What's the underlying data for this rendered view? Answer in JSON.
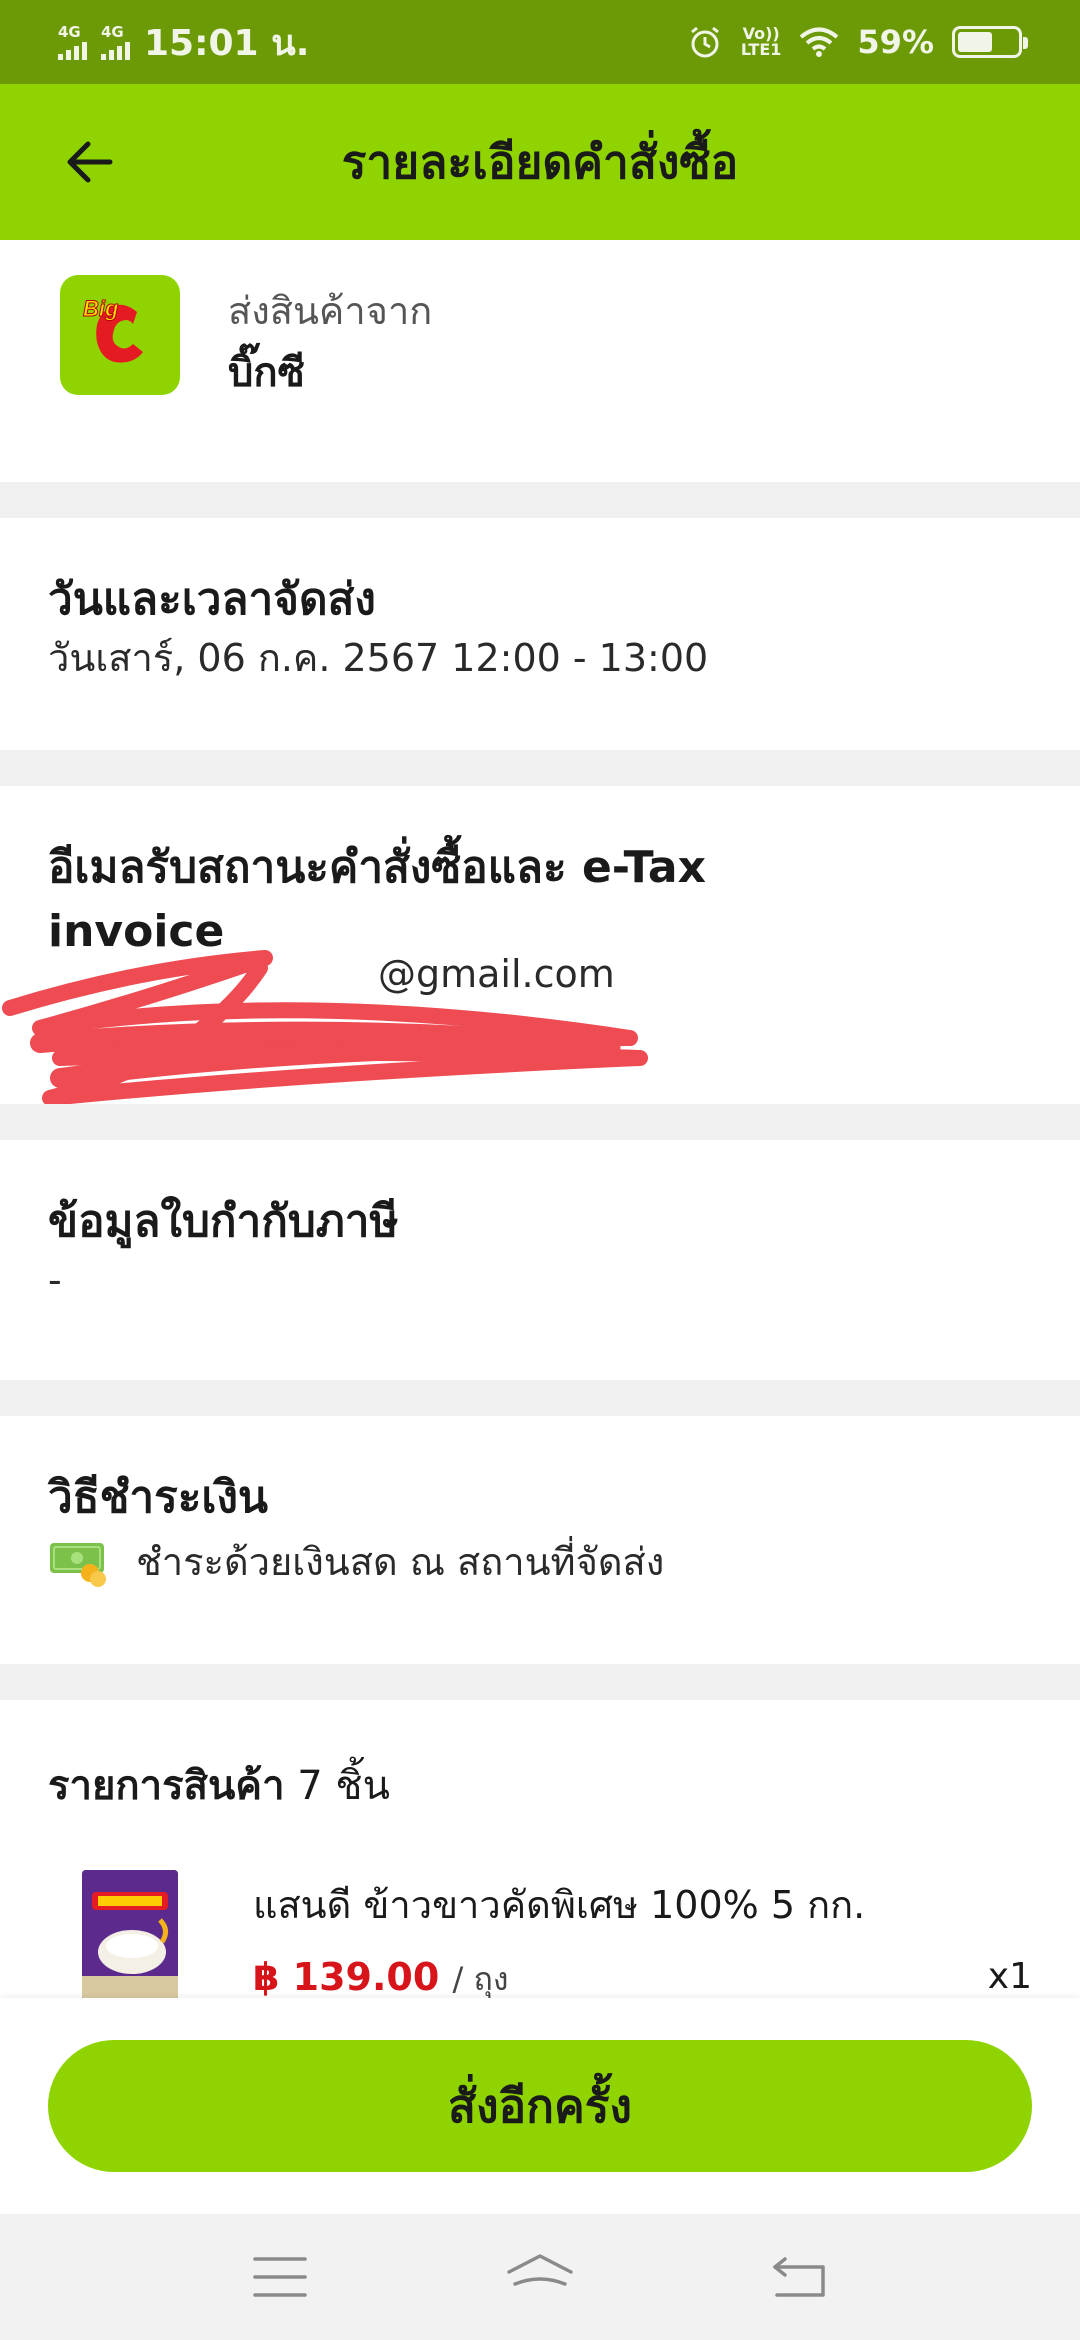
{
  "status_bar": {
    "network1": "4G",
    "network2": "4G",
    "time": "15:01 น.",
    "volte_top": "Vo))",
    "volte_bottom": "LTE1",
    "battery": "59%",
    "battery_level": 0.59
  },
  "header": {
    "title": "รายละเอียดคำสั่งซื้อ",
    "back_icon": "arrow-left-icon"
  },
  "store": {
    "from_label": "ส่งสินค้าจาก",
    "name": "บิ๊กซี",
    "logo_text": "Big",
    "logo_letter": "C"
  },
  "delivery": {
    "title": "วันและเวลาจัดส่ง",
    "value": "วันเสาร์, 06 ก.ค. 2567  12:00 - 13:00"
  },
  "email": {
    "title": "อีเมลรับสถานะคำสั่งซื้อและ e-Tax invoice",
    "value": "@gmail.com"
  },
  "tax": {
    "title": "ข้อมูลใบกำกับภาษี",
    "value": "-"
  },
  "payment": {
    "title": "วิธีชำระเงิน",
    "icon": "cash-icon",
    "value": "ชำระด้วยเงินสด ณ สถานที่จัดส่ง"
  },
  "items": {
    "title": "รายการสินค้า",
    "count": "7 ชิ้น",
    "list": [
      {
        "name": "แสนดี ข้าวขาวคัดพิเศษ 100% 5 กก.",
        "price": "฿ 139.00",
        "unit": "/ ถุง",
        "qty": "x1"
      }
    ]
  },
  "actions": {
    "reorder_label": "สั่งอีกครั้ง"
  },
  "nav": {
    "menu_icon": "menu-icon",
    "home_icon": "home-icon",
    "back_icon": "back-icon"
  },
  "colors": {
    "brand_green": "#8fd400",
    "status_green": "#6b9a06",
    "price_red": "#d7141a",
    "redaction": "#ee4b52"
  }
}
